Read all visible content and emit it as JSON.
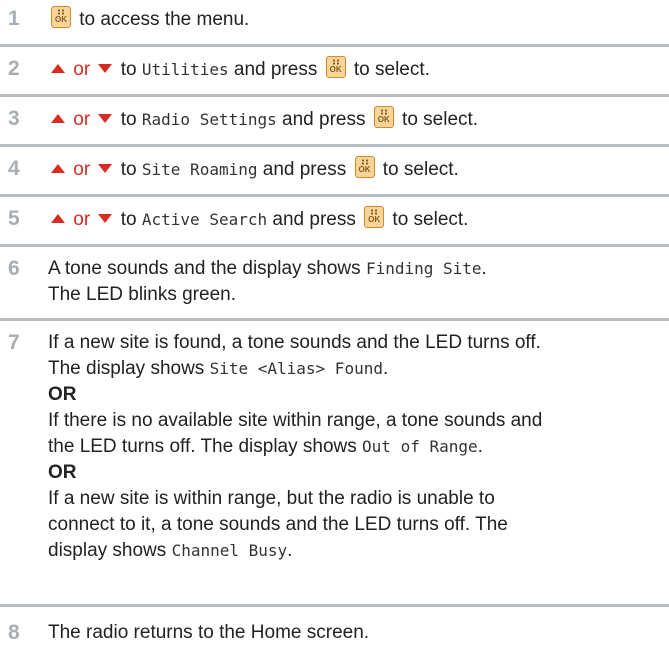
{
  "colors": {
    "step_number": "#a9aeb2",
    "separator": "#b9bec2",
    "arrow": "#d62d23",
    "button_fill": "#f7d59a",
    "button_border": "#d48a2c"
  },
  "icons": {
    "menu_ok_button": "menu-ok-button-icon",
    "up_arrow": "up-arrow-icon",
    "down_arrow": "down-arrow-icon"
  },
  "button_text": "OK",
  "or_word": "or",
  "steps": [
    {
      "number": "1",
      "text": "to access the menu."
    },
    {
      "number": "2",
      "pre": "to",
      "item": "Utilities",
      "post": "and press",
      "end": "to select."
    },
    {
      "number": "3",
      "pre": "to",
      "item": "Radio Settings",
      "post": "and press",
      "end": "to select."
    },
    {
      "number": "4",
      "pre": "to",
      "item": "Site Roaming",
      "post": "and press",
      "end": "to select."
    },
    {
      "number": "5",
      "pre": "to",
      "item": "Active Search",
      "post": "and press",
      "end": "to select."
    },
    {
      "number": "6",
      "line1": "A tone sounds and the display shows",
      "display": "Finding Site",
      "line1_end": ".",
      "line2": "The LED blinks green."
    },
    {
      "number": "7",
      "a1": "If a new site is found, a tone sounds and the LED turns off.",
      "a2": "The display shows",
      "a2_display": "Site <Alias> Found",
      "a2_end": ".",
      "or": "OR",
      "b1": "If there is no available site within range, a tone sounds and",
      "b2": "the LED turns off. The display shows",
      "b2_display": "Out of Range",
      "b2_end": ".",
      "c1": "If a new site is within range, but the radio is unable to",
      "c2": "connect to it, a tone sounds and the LED turns off. The",
      "c3": "display shows",
      "c3_display": "Channel Busy",
      "c3_end": "."
    },
    {
      "number": "8",
      "text": "The radio returns to the Home screen."
    }
  ]
}
